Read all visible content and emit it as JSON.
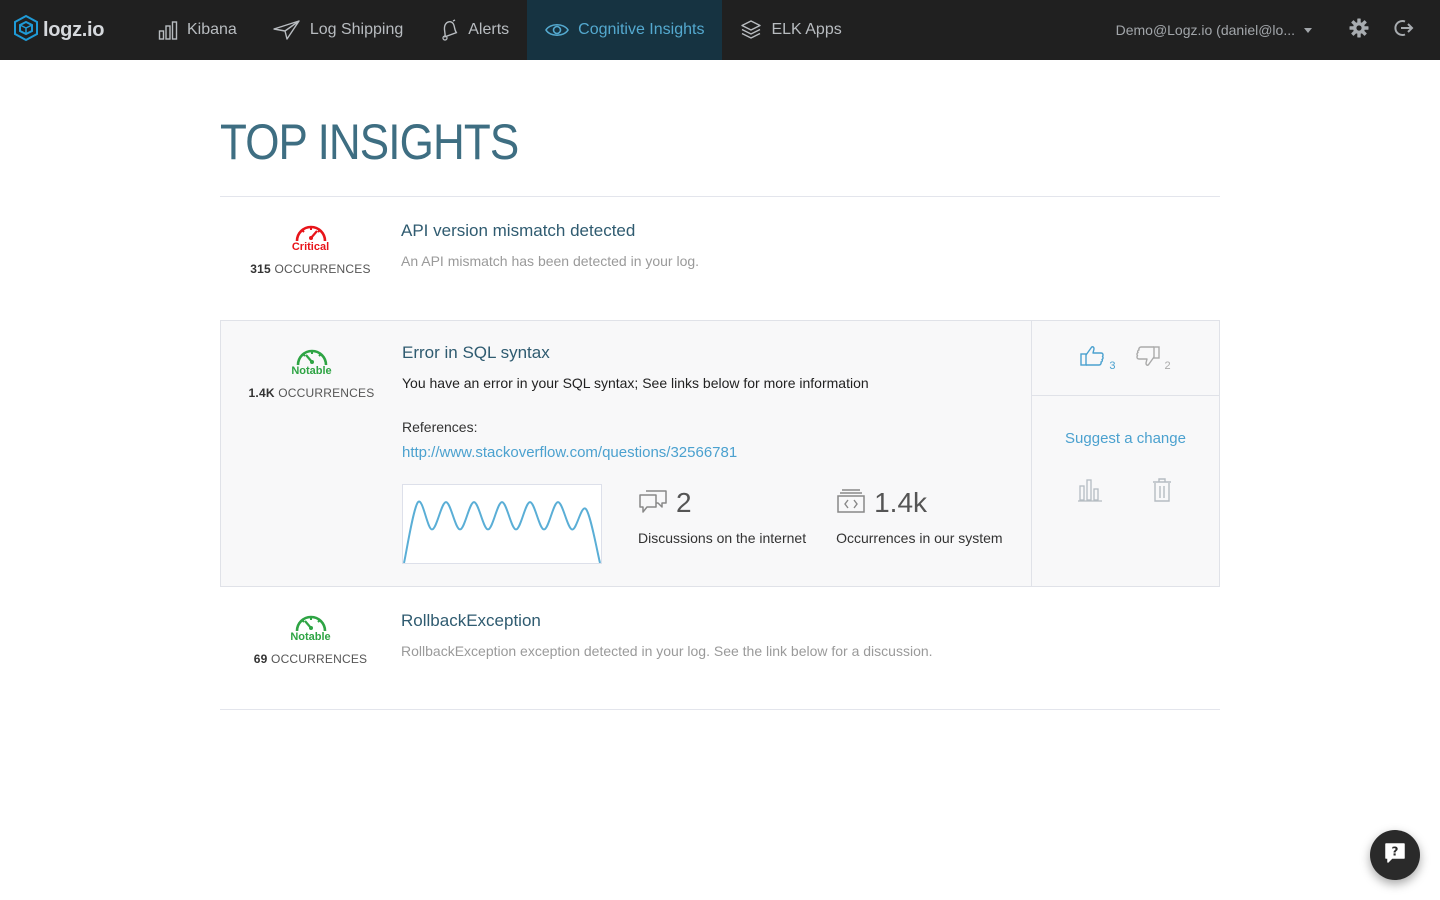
{
  "nav": {
    "logo_text": "logz.io",
    "items": [
      {
        "label": "Kibana",
        "icon": "bar-chart-icon",
        "active": false
      },
      {
        "label": "Log Shipping",
        "icon": "paper-plane-icon",
        "active": false
      },
      {
        "label": "Alerts",
        "icon": "bell-icon",
        "active": false
      },
      {
        "label": "Cognitive Insights",
        "icon": "eye-icon",
        "active": true
      },
      {
        "label": "ELK Apps",
        "icon": "layers-icon",
        "active": false
      }
    ],
    "account": "Demo@Logz.io (daniel@lo...",
    "settings_icon": "gear-icon",
    "logout_icon": "logout-icon"
  },
  "page": {
    "title": "TOP INSIGHTS"
  },
  "insights": [
    {
      "severity": "Critical",
      "severity_color": "#e8141a",
      "occurrences_count": "315",
      "occurrences_label": "OCCURRENCES",
      "title": "API version mismatch detected",
      "description": "An API mismatch has been detected in your log."
    },
    {
      "severity": "Notable",
      "severity_color": "#2ea444",
      "occurrences_count": "1.4K",
      "occurrences_label": "OCCURRENCES",
      "title": "Error in SQL syntax",
      "description": "You have an error in your SQL syntax; See links below for more information",
      "references_label": "References:",
      "reference_link": "http://www.stackoverflow.com/questions/32566781",
      "stats": [
        {
          "icon": "discussion-icon",
          "value": "2",
          "label": "Discussions on the internet"
        },
        {
          "icon": "code-stack-icon",
          "value": "1.4k",
          "label": "Occurrences in our system"
        }
      ],
      "votes": {
        "up": "3",
        "down": "2"
      },
      "suggest_label": "Suggest a change",
      "sparkline": [
        0.0,
        0.78,
        0.43,
        0.78,
        0.43,
        0.78,
        0.43,
        0.78,
        0.43,
        0.78,
        0.43,
        0.78,
        0.43,
        0.69,
        0.0
      ]
    },
    {
      "severity": "Notable",
      "severity_color": "#2ea444",
      "occurrences_count": "69",
      "occurrences_label": "OCCURRENCES",
      "title": "RollbackException",
      "description": "RollbackException exception detected in your log. See the link below for a discussion."
    }
  ],
  "help": {
    "icon": "help-chat-icon"
  }
}
